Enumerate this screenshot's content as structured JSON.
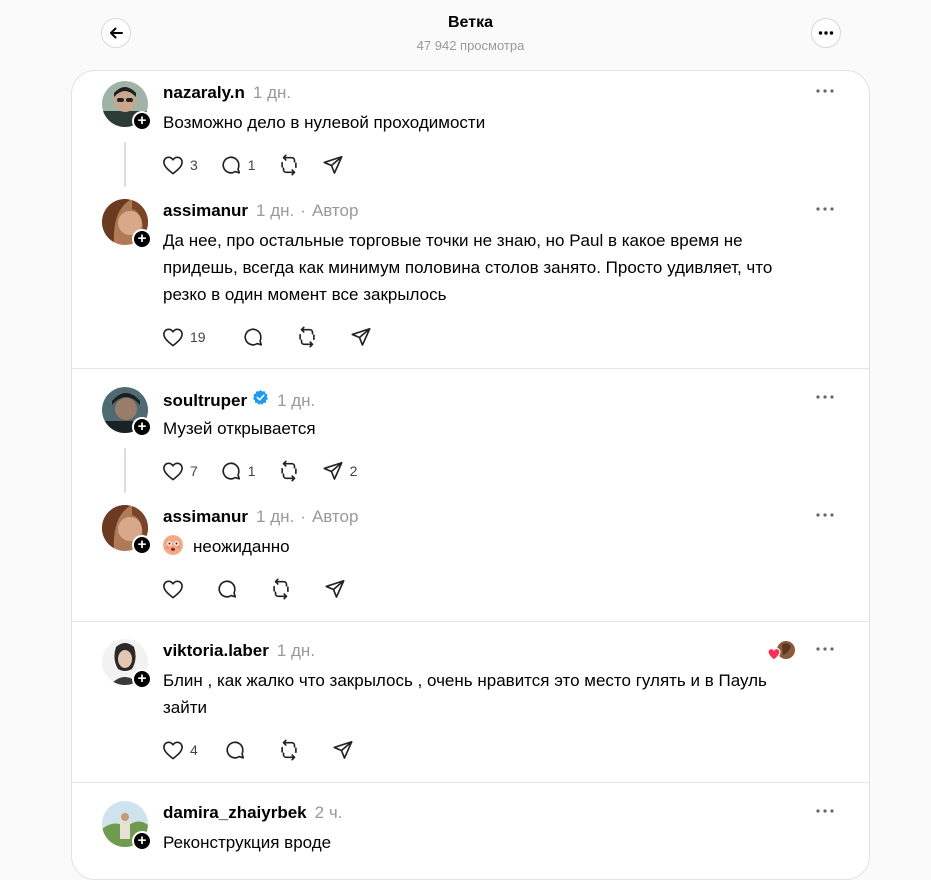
{
  "header": {
    "title": "Ветка",
    "views": "47 942 просмотра"
  },
  "icons": {
    "back": "arrow-left-icon",
    "more": "more-horizontal-icon",
    "like": "heart-icon",
    "reply": "comment-icon",
    "repost": "repost-icon",
    "share": "send-icon",
    "verified": "verified-badge-icon",
    "follow": "plus-icon"
  },
  "colors": {
    "verified": "#1d9bf0",
    "reaction_heart": "#ff2d55"
  },
  "posts": [
    {
      "username": "nazaraly.n",
      "time": "1 дн.",
      "author_tag": "",
      "text": "Возможно дело в нулевой проходимости",
      "likes": "3",
      "replies": "1",
      "reposts": "",
      "shares": ""
    },
    {
      "username": "assimanur",
      "time": "1 дн.",
      "author_tag": "Автор",
      "text": "Да нее, про остальные торговые точки не знаю, но Paul в какое время не придешь, всегда как минимум половина столов занято. Просто удивляет, что резко в один момент все закрылось",
      "likes": "19",
      "replies": "",
      "reposts": "",
      "shares": ""
    },
    {
      "username": "soultruper",
      "time": "1 дн.",
      "author_tag": "",
      "text": "Музей открывается",
      "likes": "7",
      "replies": "1",
      "reposts": "",
      "shares": "2"
    },
    {
      "username": "assimanur",
      "time": "1 дн.",
      "author_tag": "Автор",
      "text": "неожиданно",
      "likes": "",
      "replies": "",
      "reposts": "",
      "shares": ""
    },
    {
      "username": "viktoria.laber",
      "time": "1 дн.",
      "author_tag": "",
      "text": "Блин , как жалко что закрылось , очень нравится это место гулять и в Пауль зайти",
      "likes": "4",
      "replies": "",
      "reposts": "",
      "shares": ""
    },
    {
      "username": "damira_zhaiyrbek",
      "time": "2 ч.",
      "author_tag": "",
      "text": "Реконструкция вроде",
      "likes": "",
      "replies": "",
      "reposts": "",
      "shares": ""
    }
  ]
}
